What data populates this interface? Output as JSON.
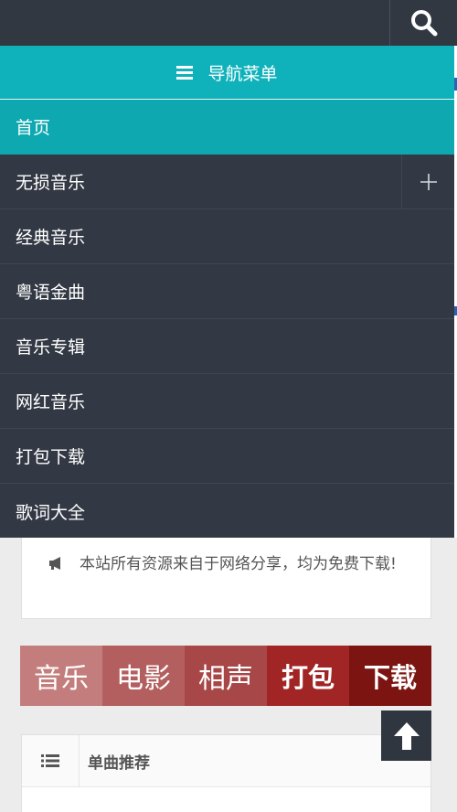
{
  "topbar": {
    "search_icon": "search-icon"
  },
  "nav": {
    "header_label": "导航菜单",
    "items": [
      {
        "label": "首页",
        "active": true
      },
      {
        "label": "无损音乐",
        "expandable": true
      },
      {
        "label": "经典音乐"
      },
      {
        "label": "粤语金曲"
      },
      {
        "label": "音乐专辑"
      },
      {
        "label": "网红音乐"
      },
      {
        "label": "打包下载"
      },
      {
        "label": "歌词大全"
      }
    ]
  },
  "notice": {
    "text": "本站所有资源来自于网络分享，均为免费下载!"
  },
  "categories": [
    {
      "label": "音乐",
      "color": "#c47d7d"
    },
    {
      "label": "电影",
      "color": "#b35f5f"
    },
    {
      "label": "相声",
      "color": "#a84747"
    },
    {
      "label": "打包",
      "color": "#a12525"
    },
    {
      "label": "下载",
      "color": "#7c1512"
    }
  ],
  "recommend": {
    "title": "单曲推荐"
  },
  "colors": {
    "dark": "#323842",
    "teal": "#0fb2bb",
    "active": "#0ea8b0"
  }
}
